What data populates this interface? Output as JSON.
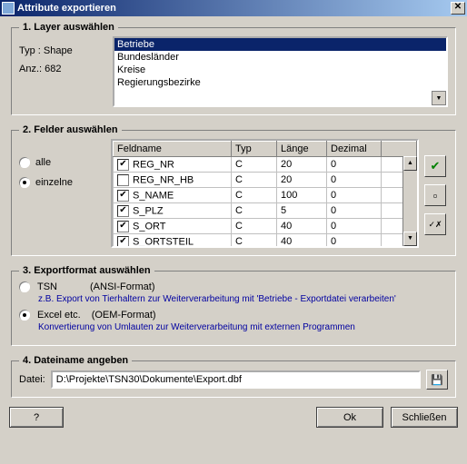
{
  "title": "Attribute exportieren",
  "close_x": "✕",
  "sec1": {
    "legend": "1. Layer auswählen",
    "typ_label": "Typ :",
    "typ_value": "Shape",
    "anz_label": "Anz.:",
    "anz_value": "682",
    "items": [
      "Betriebe",
      "Bundesländer",
      "Kreise",
      "Regierungsbezirke"
    ],
    "selected": 0
  },
  "sec2": {
    "legend": "2. Felder auswählen",
    "radio_all": "alle",
    "radio_single": "einzelne",
    "headers": [
      "Feldname",
      "Typ",
      "Länge",
      "Dezimal",
      ""
    ],
    "rows": [
      {
        "chk": true,
        "name": "REG_NR",
        "typ": "C",
        "len": "20",
        "dez": "0"
      },
      {
        "chk": false,
        "name": "REG_NR_HB",
        "typ": "C",
        "len": "20",
        "dez": "0"
      },
      {
        "chk": true,
        "name": "S_NAME",
        "typ": "C",
        "len": "100",
        "dez": "0"
      },
      {
        "chk": true,
        "name": "S_PLZ",
        "typ": "C",
        "len": "5",
        "dez": "0"
      },
      {
        "chk": true,
        "name": "S_ORT",
        "typ": "C",
        "len": "40",
        "dez": "0"
      },
      {
        "chk": true,
        "name": "S_ORTSTEIL",
        "typ": "C",
        "len": "40",
        "dez": "0"
      }
    ],
    "btn_all_glyph": "✔",
    "btn_none_glyph": "▫",
    "btn_invert_glyph": "✓✗"
  },
  "sec3": {
    "legend": "3. Exportformat auswählen",
    "tsn_label": "TSN",
    "tsn_sub": "(ANSI-Format)",
    "tsn_desc": "z.B. Export von Tierhaltern zur Weiterverarbeitung mit 'Betriebe - Exportdatei verarbeiten'",
    "excel_label": "Excel etc.",
    "excel_sub": "(OEM-Format)",
    "excel_desc": "Konvertierung von Umlauten zur Weiterverarbeitung mit externen Programmen"
  },
  "sec4": {
    "legend": "4. Dateiname angeben",
    "file_label": "Datei:",
    "file_value": "D:\\Projekte\\TSN30\\Dokumente\\Export.dbf",
    "disk_glyph": "💾"
  },
  "buttons": {
    "help": "?",
    "ok": "Ok",
    "close": "Schließen"
  }
}
